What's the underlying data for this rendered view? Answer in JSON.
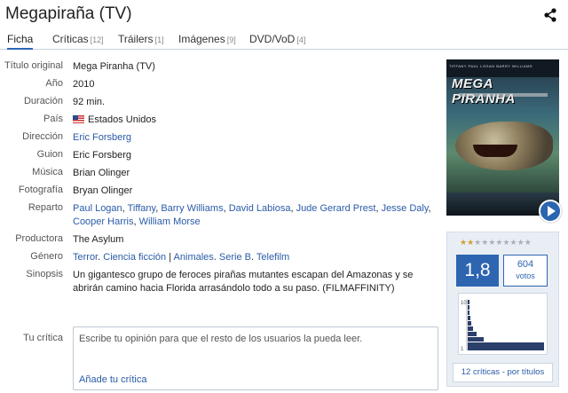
{
  "title": "Megapiraña (TV)",
  "share_icon": "share-icon",
  "tabs": [
    {
      "label": "Ficha",
      "count": ""
    },
    {
      "label": "Críticas",
      "count": "[12]"
    },
    {
      "label": "Tráilers",
      "count": "[1]"
    },
    {
      "label": "Imágenes",
      "count": "[9]"
    },
    {
      "label": "DVD/VoD",
      "count": "[4]"
    }
  ],
  "info": {
    "original_title": {
      "label": "Título original",
      "value": "Mega Piranha (TV)"
    },
    "year": {
      "label": "Año",
      "value": "2010"
    },
    "duration": {
      "label": "Duración",
      "value": "92 min."
    },
    "country": {
      "label": "País",
      "value": "Estados Unidos",
      "flag_icon": "us-flag-icon"
    },
    "director": {
      "label": "Dirección",
      "value": "Eric Forsberg"
    },
    "writer": {
      "label": "Guion",
      "value": "Eric Forsberg"
    },
    "music": {
      "label": "Música",
      "value": "Brian Olinger"
    },
    "photography": {
      "label": "Fotografía",
      "value": "Bryan Olinger"
    },
    "cast": {
      "label": "Reparto",
      "names": [
        "Paul Logan",
        "Tiffany",
        "Barry Williams",
        "David Labiosa",
        "Jude Gerard Prest",
        "Jesse Daly",
        "Cooper Harris",
        "William Morse"
      ]
    },
    "producer": {
      "label": "Productora",
      "value": "The Asylum"
    },
    "genre": {
      "label": "Género",
      "items": [
        "Terror",
        "Ciencia ficción",
        "Animales",
        "Serie B",
        "Telefilm"
      ]
    },
    "synopsis": {
      "label": "Sinopsis",
      "value": "Un gigantesco grupo de feroces pirañas mutantes escapan del Amazonas y se abrirán camino hacia Florida arrasándolo todo a su paso. (FILMAFFINITY)"
    }
  },
  "critic": {
    "label": "Tu crítica",
    "placeholder": "Escribe tu opinión para que el resto de los usuarios la pueda leer.",
    "add_link": "Añade tu crítica"
  },
  "poster": {
    "title": "MEGA PIRANHA",
    "credits": "TIFFANY    PAUL LOGAN    BARRY WILLIAMS"
  },
  "rating": {
    "stars_filled": 2,
    "stars_total": 10,
    "average": "1,8",
    "votes": "604",
    "votes_label": "votos",
    "histogram_max_label": "10",
    "histogram_min_label": "1",
    "reviews_link": "12 críticas - por títulos"
  },
  "colors": {
    "accent": "#2e65b1",
    "link": "#2a5ba8",
    "star": "#d3a13a"
  }
}
